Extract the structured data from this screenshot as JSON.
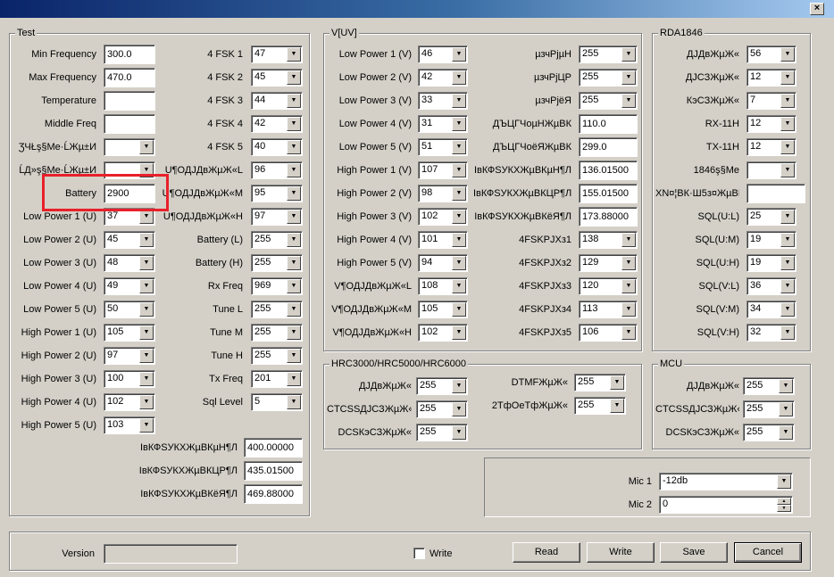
{
  "window": {
    "close": "×"
  },
  "test": {
    "title": "Test",
    "left": [
      {
        "label": "Min Frequency",
        "value": "300.0",
        "type": "text"
      },
      {
        "label": "Max Frequency",
        "value": "470.0",
        "type": "text"
      },
      {
        "label": "Temperature",
        "value": "",
        "type": "text"
      },
      {
        "label": "Middle Freq",
        "value": "",
        "type": "text"
      },
      {
        "label": "ƷЧŁş§Me·ĹЖµ±И",
        "value": "",
        "type": "combo"
      },
      {
        "label": "ĹД»ş§Me·ĹЖµ±И",
        "value": "",
        "type": "combo"
      },
      {
        "label": "Battery",
        "value": "2900",
        "type": "text"
      },
      {
        "label": "Low Power 1 (U)",
        "value": "37",
        "type": "combo"
      },
      {
        "label": "Low Power 2 (U)",
        "value": "45",
        "type": "combo"
      },
      {
        "label": "Low Power 3 (U)",
        "value": "48",
        "type": "combo"
      },
      {
        "label": "Low Power 4 (U)",
        "value": "49",
        "type": "combo"
      },
      {
        "label": "Low Power 5 (U)",
        "value": "50",
        "type": "combo"
      },
      {
        "label": "High Power 1 (U)",
        "value": "105",
        "type": "combo"
      },
      {
        "label": "High Power 2 (U)",
        "value": "97",
        "type": "combo"
      },
      {
        "label": "High Power 3 (U)",
        "value": "100",
        "type": "combo"
      },
      {
        "label": "High Power 4 (U)",
        "value": "102",
        "type": "combo"
      },
      {
        "label": "High Power 5 (U)",
        "value": "103",
        "type": "combo"
      }
    ],
    "right": [
      {
        "label": "4 FSK 1",
        "value": "47"
      },
      {
        "label": "4 FSK 2",
        "value": "45"
      },
      {
        "label": "4 FSK 3",
        "value": "44"
      },
      {
        "label": "4 FSK 4",
        "value": "42"
      },
      {
        "label": "4 FSK 5",
        "value": "40"
      },
      {
        "label": "U¶ОДЈДвЖµЖ«L",
        "value": "96"
      },
      {
        "label": "U¶ОДЈДвЖµЖ«M",
        "value": "95"
      },
      {
        "label": "U¶ОДЈДвЖµЖ«H",
        "value": "97"
      },
      {
        "label": "Battery (L)",
        "value": "255"
      },
      {
        "label": "Battery (H)",
        "value": "255"
      },
      {
        "label": "Rx Freq",
        "value": "969"
      },
      {
        "label": "Tune L",
        "value": "255"
      },
      {
        "label": "Tune M",
        "value": "255"
      },
      {
        "label": "Tune H",
        "value": "255"
      },
      {
        "label": "Tx Freq",
        "value": "201"
      },
      {
        "label": "Sql Level",
        "value": "5"
      }
    ],
    "bottom": [
      {
        "label": "ІвКФSУКХЖµВКµН¶Л",
        "value": "400.00000"
      },
      {
        "label": "ІвКФSУКХЖµВКЦР¶Л",
        "value": "435.01500"
      },
      {
        "label": "ІвКФSУКХЖµВКёЯ¶Л",
        "value": "469.88000"
      }
    ]
  },
  "vuv": {
    "title": "V[UV]",
    "left": [
      {
        "label": "Low Power 1 (V)",
        "value": "46"
      },
      {
        "label": "Low Power 2 (V)",
        "value": "42"
      },
      {
        "label": "Low Power 3 (V)",
        "value": "33"
      },
      {
        "label": "Low Power 4 (V)",
        "value": "31"
      },
      {
        "label": "Low Power 5 (V)",
        "value": "51"
      },
      {
        "label": "High Power 1 (V)",
        "value": "107"
      },
      {
        "label": "High Power 2 (V)",
        "value": "98"
      },
      {
        "label": "High Power 3 (V)",
        "value": "102"
      },
      {
        "label": "High Power 4 (V)",
        "value": "101"
      },
      {
        "label": "High Power 5 (V)",
        "value": "94"
      },
      {
        "label": "V¶ОДЈДвЖµЖ«L",
        "value": "108"
      },
      {
        "label": "V¶ОДЈДвЖµЖ«M",
        "value": "105"
      },
      {
        "label": "V¶ОДЈДвЖµЖ«H",
        "value": "102"
      }
    ],
    "right": [
      {
        "label": "µзчРјµН",
        "value": "255",
        "type": "combo"
      },
      {
        "label": "µзчРјЦР",
        "value": "255",
        "type": "combo"
      },
      {
        "label": "µзчРјёЯ",
        "value": "255",
        "type": "combo"
      },
      {
        "label": "ДЪЦГЧоµНЖµВК",
        "value": "110.0",
        "type": "text"
      },
      {
        "label": "ДЪЦГЧоёЯЖµВК",
        "value": "299.0",
        "type": "text"
      },
      {
        "label": "ІвКФSУКХЖµВКµН¶Л",
        "value": "136.01500",
        "type": "text"
      },
      {
        "label": "ІвКФSУКХЖµВКЦР¶Л",
        "value": "155.01500",
        "type": "text"
      },
      {
        "label": "ІвКФSУКХЖµВКёЯ¶Л",
        "value": "173.88000",
        "type": "text"
      },
      {
        "label": "4FSKPJXз1",
        "value": "138",
        "type": "combo"
      },
      {
        "label": "4FSKPJXз2",
        "value": "129",
        "type": "combo"
      },
      {
        "label": "4FSKPJXз3",
        "value": "120",
        "type": "combo"
      },
      {
        "label": "4FSKPJXз4",
        "value": "113",
        "type": "combo"
      },
      {
        "label": "4FSKPJXз5",
        "value": "106",
        "type": "combo"
      }
    ]
  },
  "rda": {
    "title": "RDA1846",
    "rows": [
      {
        "label": "ДЈДвЖµЖ«",
        "value": "56",
        "type": "combo"
      },
      {
        "label": "ДЈСЗЖµЖ«",
        "value": "12",
        "type": "combo"
      },
      {
        "label": "КэСЗЖµЖ«",
        "value": "7",
        "type": "combo"
      },
      {
        "label": "RX-11H",
        "value": "12",
        "type": "combo"
      },
      {
        "label": "TX-11H",
        "value": "12",
        "type": "combo"
      },
      {
        "label": "1846ş§Me",
        "value": "",
        "type": "combo"
      },
      {
        "label": "ХN¤¦ВК·Ш5з¤ЖµВК",
        "value": "",
        "type": "text"
      },
      {
        "label": "SQL(U:L)",
        "value": "25",
        "type": "combo"
      },
      {
        "label": "SQL(U:M)",
        "value": "19",
        "type": "combo"
      },
      {
        "label": "SQL(U:H)",
        "value": "19",
        "type": "combo"
      },
      {
        "label": "SQL(V:L)",
        "value": "36",
        "type": "combo"
      },
      {
        "label": "SQL(V:M)",
        "value": "34",
        "type": "combo"
      },
      {
        "label": "SQL(V:H)",
        "value": "32",
        "type": "combo"
      }
    ]
  },
  "hrc": {
    "title": "HRC3000/HRC5000/HRC6000",
    "left": [
      {
        "label": "ДЈДвЖµЖ«",
        "value": "255"
      },
      {
        "label": "CTCSSДЈСЗЖµЖ«",
        "value": "255"
      },
      {
        "label": "DCSКэСЗЖµЖ«",
        "value": "255"
      }
    ],
    "right": [
      {
        "label": "DTMFЖµЖ«",
        "value": "255"
      },
      {
        "label": "2ТфОеТфЖµЖ«",
        "value": "255"
      }
    ]
  },
  "mcu": {
    "title": "MCU",
    "rows": [
      {
        "label": "ДЈДвЖµЖ«",
        "value": "255"
      },
      {
        "label": "CTCSSДЈСЗЖµЖ«",
        "value": "255"
      },
      {
        "label": "DCSКэСЗЖµЖ«",
        "value": "255"
      }
    ]
  },
  "mic": {
    "mic1_label": "Mic 1",
    "mic1_value": "-12db",
    "mic2_label": "Mic 2",
    "mic2_value": "0"
  },
  "footer": {
    "version_label": "Version",
    "version_value": "",
    "write_label": "Write",
    "write_checked": false,
    "read_btn": "Read",
    "write_btn": "Write",
    "save_btn": "Save",
    "cancel_btn": "Cancel"
  },
  "highlight": {
    "color": "#e8202a"
  }
}
